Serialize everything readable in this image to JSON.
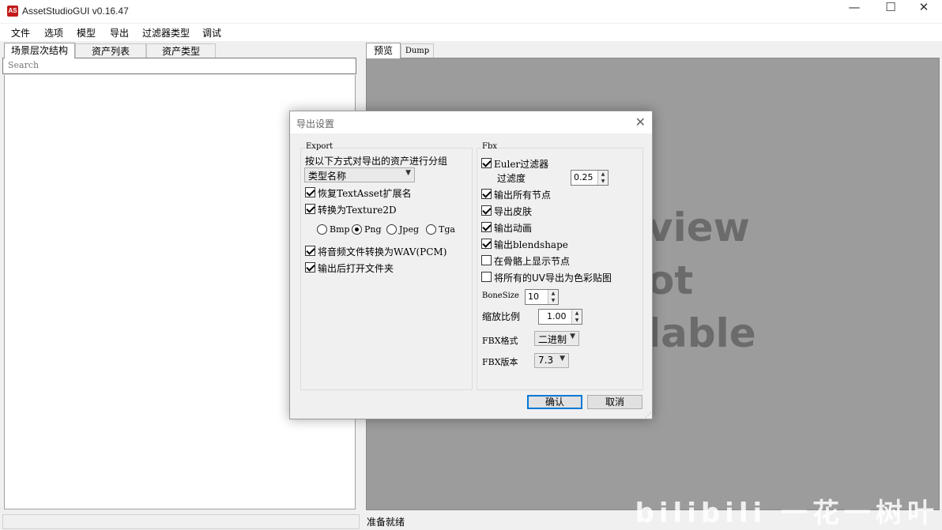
{
  "window": {
    "app_icon_text": "AS",
    "title": "AssetStudioGUI v0.16.47",
    "minimize": "—",
    "maximize": "☐",
    "close": "✕"
  },
  "menu": {
    "items": [
      "文件",
      "选项",
      "模型",
      "导出",
      "过滤器类型",
      "调试"
    ]
  },
  "left": {
    "tabs": [
      "场景层次结构",
      "资产列表",
      "资产类型"
    ],
    "search_placeholder": "Search"
  },
  "right": {
    "tabs": [
      "预览",
      "Dump"
    ],
    "preview_lines": [
      "view",
      "ot",
      "lable"
    ],
    "status": "准备就绪",
    "watermark": "bilibili 一花一树叶"
  },
  "dialog": {
    "title": "导出设置",
    "close": "✕",
    "export_group": {
      "label": "Export",
      "group_by_label": "按以下方式对导出的资产进行分组",
      "group_by_value": "类型名称",
      "restore_textasset": {
        "label": "恢复TextAsset扩展名",
        "checked": true
      },
      "convert_texture2d": {
        "label": "转换为Texture2D",
        "checked": true
      },
      "image_formats": [
        {
          "label": "Bmp",
          "selected": false
        },
        {
          "label": "Png",
          "selected": true
        },
        {
          "label": "Jpeg",
          "selected": false
        },
        {
          "label": "Tga",
          "selected": false
        }
      ],
      "convert_audio": {
        "label": "将音频文件转换为WAV(PCM)",
        "checked": true
      },
      "open_folder": {
        "label": "输出后打开文件夹",
        "checked": true
      }
    },
    "fbx_group": {
      "label": "Fbx",
      "euler_filter": {
        "label": "Euler过滤器",
        "checked": true
      },
      "filter_precision_label": "过滤度",
      "filter_precision_value": "0.25",
      "export_all_nodes": {
        "label": "输出所有节点",
        "checked": true
      },
      "export_skins": {
        "label": "导出皮肤",
        "checked": true
      },
      "export_animations": {
        "label": "输出动画",
        "checked": true
      },
      "export_blendshape": {
        "label": "输出blendshape",
        "checked": true
      },
      "display_bone_nodes": {
        "label": "在骨骼上显示节点",
        "checked": false
      },
      "export_uv_as_diffuse": {
        "label": "将所有的UV导出为色彩贴图",
        "checked": false
      },
      "bone_size_label": "BoneSize",
      "bone_size_value": "10",
      "scale_factor_label": "缩放比例",
      "scale_factor_value": "1.00",
      "fbx_format_label": "FBX格式",
      "fbx_format_value": "二进制",
      "fbx_version_label": "FBX版本",
      "fbx_version_value": "7.3"
    },
    "ok": "确认",
    "cancel": "取消"
  }
}
